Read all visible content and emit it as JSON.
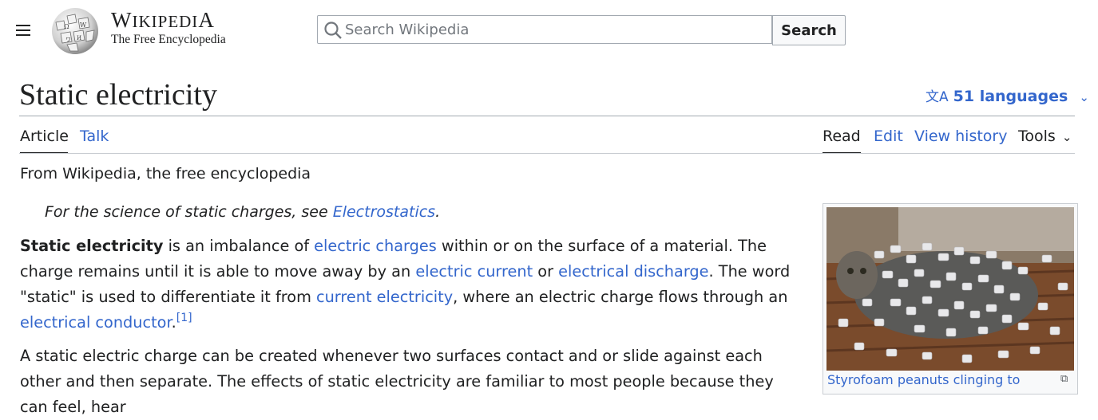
{
  "header": {
    "wordmark_title_first": "W",
    "wordmark_title_rest": "IKIPEDI",
    "wordmark_title_last": "A",
    "tagline": "The Free Encyclopedia",
    "search_placeholder": "Search Wikipedia",
    "search_button": "Search"
  },
  "page": {
    "title": "Static electricity",
    "languages_label": "51 languages"
  },
  "tabs": {
    "article": "Article",
    "talk": "Talk",
    "read": "Read",
    "edit": "Edit",
    "view_history": "View history",
    "tools": "Tools"
  },
  "content": {
    "from": "From Wikipedia, the free encyclopedia",
    "hatnote_prefix": "For the science of static charges, see ",
    "hatnote_link": "Electrostatics",
    "hatnote_suffix": ".",
    "p1": {
      "bold": "Static electricity",
      "t1": " is an imbalance of ",
      "l1": "electric charges",
      "t2": " within or on the surface of a material. The charge remains until it is able to move away by an ",
      "l2": "electric current",
      "t3": " or ",
      "l3": "electrical discharge",
      "t4": ". The word \"static\" is used to differentiate it from ",
      "l4": "current electricity",
      "t5": ", where an electric charge flows through an ",
      "l5": "electrical conductor",
      "t6": ".",
      "ref": "[1]"
    },
    "p2": "A static electric charge can be created whenever two surfaces contact and or slide against each other and then separate. The effects of static electricity are familiar to most people because they can feel, hear"
  },
  "infobox": {
    "caption": "Styrofoam peanuts clinging to"
  },
  "colors": {
    "link": "#3366cc",
    "text": "#202122",
    "border": "#a2a9b1"
  }
}
